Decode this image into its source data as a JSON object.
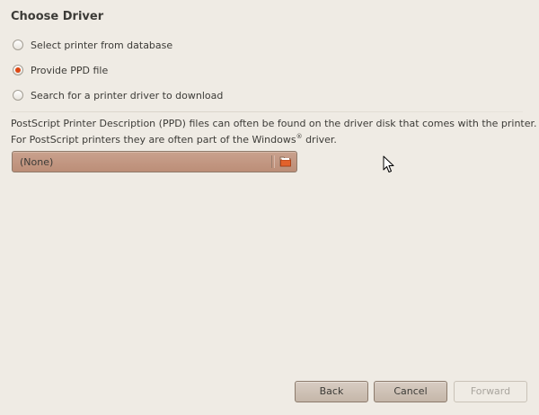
{
  "page": {
    "title": "Choose Driver"
  },
  "options": [
    {
      "label": "Select printer from database",
      "selected": false
    },
    {
      "label": "Provide PPD file",
      "selected": true
    },
    {
      "label": "Search for a printer driver to download",
      "selected": false
    }
  ],
  "description": {
    "line1": "PostScript Printer Description (PPD) files can often be found on the driver disk that comes with the printer.",
    "line2_before": "For PostScript printers they are often part of the Windows",
    "line2_sup": "®",
    "line2_after": " driver."
  },
  "file_chooser": {
    "value": "(None)",
    "icon": "folder-open-icon"
  },
  "buttons": {
    "back": "Back",
    "cancel": "Cancel",
    "forward": "Forward"
  },
  "colors": {
    "accent": "#dd4814",
    "chooser_bg": "#c39885",
    "window_bg": "#efebe4"
  }
}
